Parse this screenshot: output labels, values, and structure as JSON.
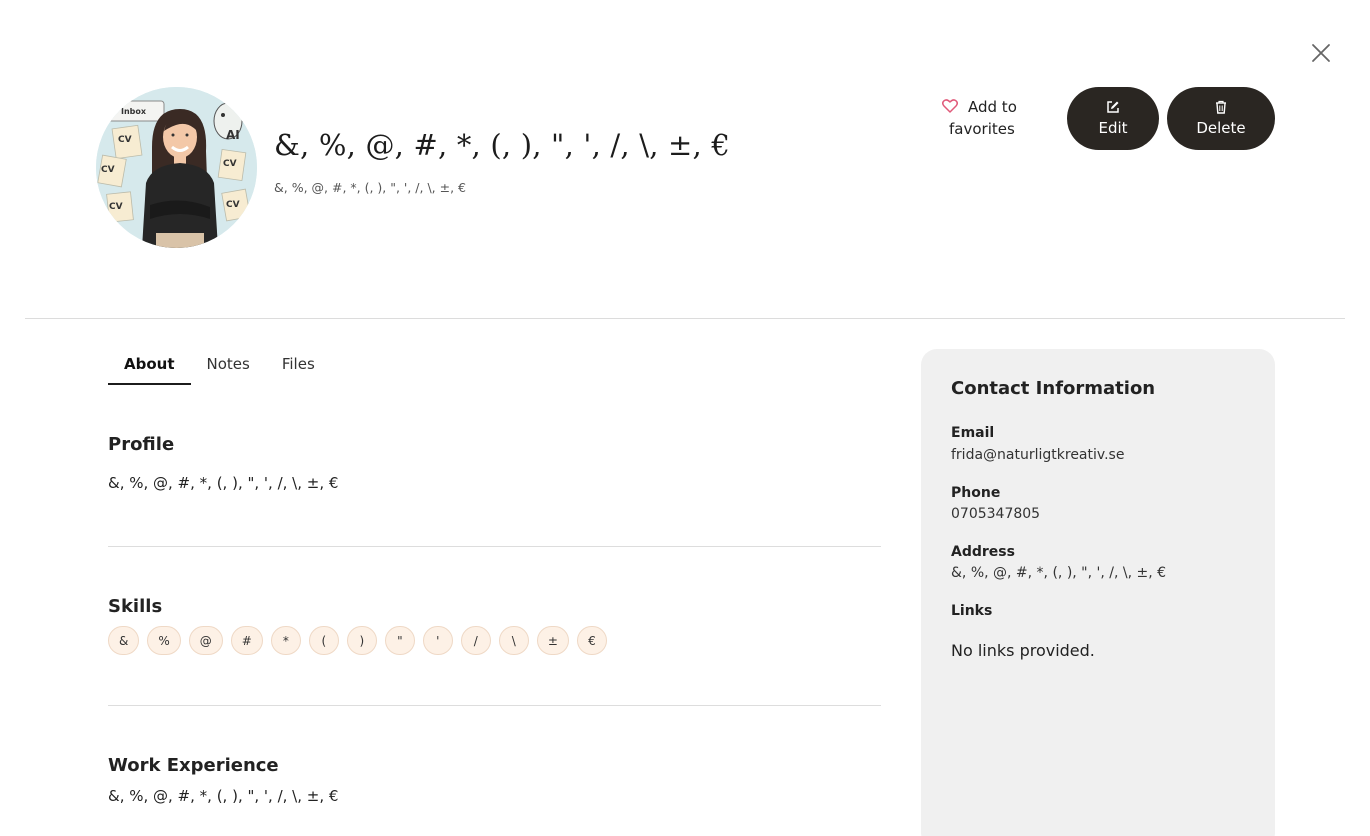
{
  "header": {
    "name": "&, %, @, #, *, (, ), \", ', /, \\, ±, €",
    "subtitle": "&, %, @, #, *, (, ), \", ', /, \\, ±, €",
    "favorite_label_line1": "Add to",
    "favorite_label_line2": "favorites",
    "edit_label": "Edit",
    "delete_label": "Delete",
    "avatar": {
      "inbox_label": "Inbox",
      "ai_label": "AI",
      "cv_label": "CV"
    }
  },
  "tabs": [
    {
      "label": "About",
      "active": true
    },
    {
      "label": "Notes",
      "active": false
    },
    {
      "label": "Files",
      "active": false
    }
  ],
  "about": {
    "profile_title": "Profile",
    "profile_text": "&, %, @, #, *, (, ), \", ', /, \\, ±, €",
    "skills_title": "Skills",
    "skills": [
      "&",
      "%",
      "@",
      "#",
      "*",
      "(",
      ")",
      "\"",
      "'",
      "/",
      "\\",
      "±",
      "€"
    ],
    "work_title": "Work Experience",
    "work_text": "&, %, @, #, *, (, ), \", ', /, \\, ±, €"
  },
  "contact": {
    "title": "Contact Information",
    "email_label": "Email",
    "email": "frida@naturligtkreativ.se",
    "phone_label": "Phone",
    "phone": "0705347805",
    "address_label": "Address",
    "address": "&, %, @, #, *, (, ), \", ', /, \\, ±, €",
    "links_label": "Links",
    "links_empty": "No links provided."
  },
  "colors": {
    "dark_button": "#2a2622",
    "heart": "#e05a7a",
    "chip_bg": "#fdf1e6",
    "card_bg": "#f0f0f0"
  },
  "icons": {
    "close": "close-icon",
    "heart": "heart-icon",
    "edit": "edit-icon",
    "delete": "trash-icon"
  }
}
